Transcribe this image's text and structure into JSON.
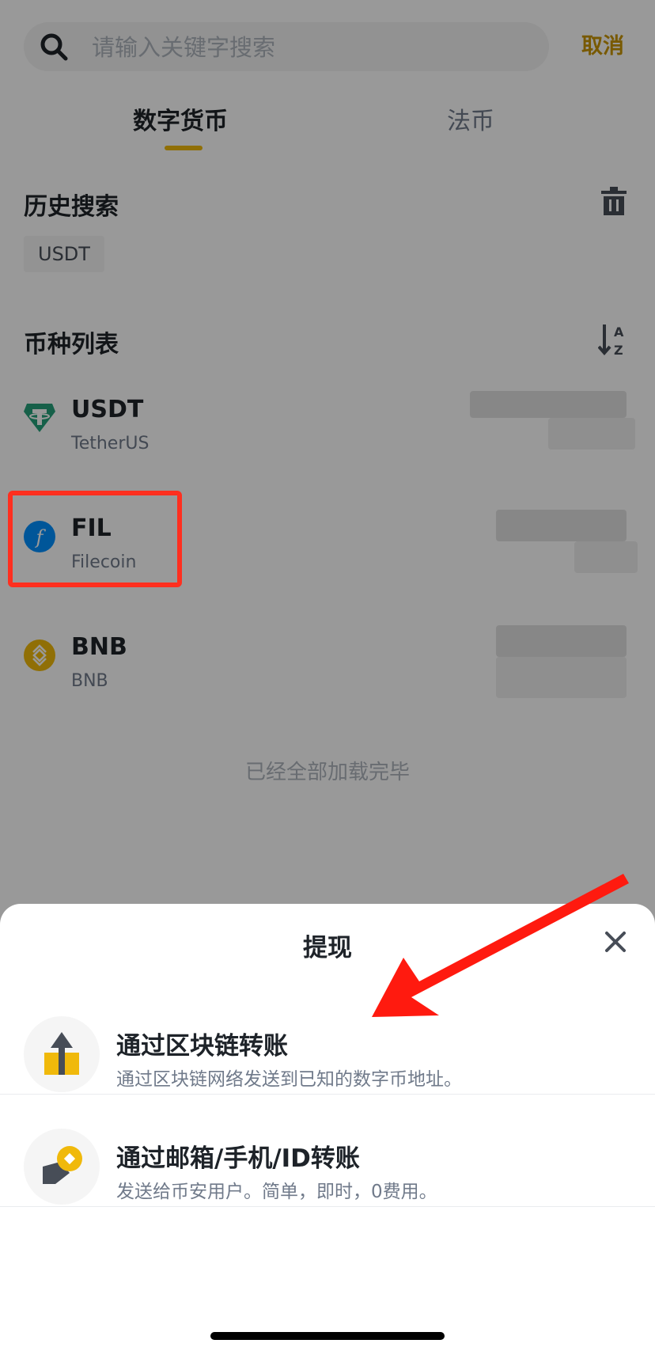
{
  "search": {
    "placeholder": "请输入关键字搜索",
    "cancel_label": "取消"
  },
  "tabs": [
    {
      "label": "数字货币",
      "active": true
    },
    {
      "label": "法币",
      "active": false
    }
  ],
  "history": {
    "title": "历史搜索",
    "chips": [
      "USDT"
    ]
  },
  "coin_list": {
    "title": "币种列表",
    "coins": [
      {
        "symbol": "USDT",
        "name": "TetherUS",
        "icon": "tether-icon",
        "color": "#26a17b"
      },
      {
        "symbol": "FIL",
        "name": "Filecoin",
        "icon": "filecoin-icon",
        "color": "#0090ff"
      },
      {
        "symbol": "BNB",
        "name": "BNB",
        "icon": "bnb-icon",
        "color": "#f0b90b"
      }
    ],
    "loaded_text": "已经全部加载完毕"
  },
  "sheet": {
    "title": "提现",
    "options": [
      {
        "title": "通过区块链转账",
        "desc": "通过区块链网络发送到已知的数字币地址。",
        "icon": "upload-icon"
      },
      {
        "title": "通过邮箱/手机/ID转账",
        "desc": "发送给币安用户。简单，即时，0费用。",
        "icon": "pay-icon"
      }
    ]
  },
  "colors": {
    "accent": "#f0b90b",
    "accent_text": "#c99400",
    "highlight": "#ff2f1f",
    "overlay": "rgba(0,0,0,0.40)"
  }
}
